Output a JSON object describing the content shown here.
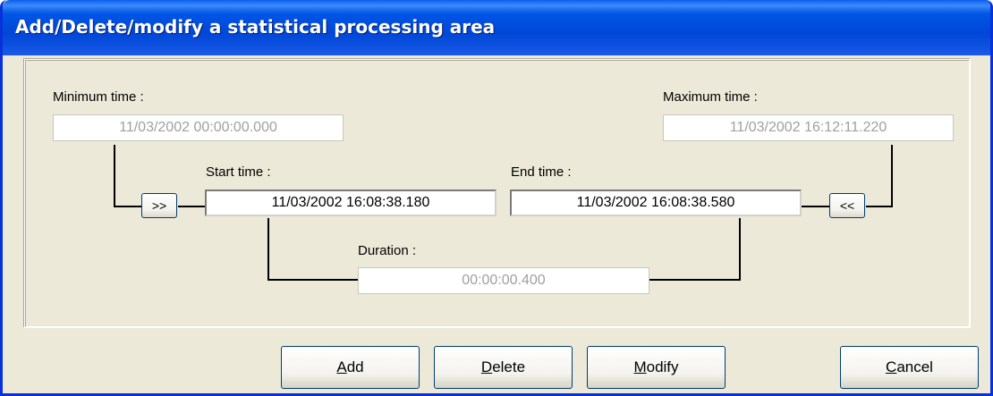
{
  "window": {
    "title": "Add/Delete/modify a statistical processing area"
  },
  "fields": {
    "minimum_time": {
      "label": "Minimum time :",
      "value": "11/03/2002 00:00:00.000"
    },
    "maximum_time": {
      "label": "Maximum time :",
      "value": "11/03/2002 16:12:11.220"
    },
    "start_time": {
      "label": "Start time :",
      "value": "11/03/2002 16:08:38.180"
    },
    "end_time": {
      "label": "End time :",
      "value": "11/03/2002 16:08:38.580"
    },
    "duration": {
      "label": "Duration :",
      "value": "00:00:00.400"
    }
  },
  "small_buttons": {
    "copy_min": ">>",
    "copy_max": "<<"
  },
  "buttons": {
    "add": {
      "mnemonic": "A",
      "rest": "dd"
    },
    "delete": {
      "mnemonic": "D",
      "rest": "elete"
    },
    "modify": {
      "mnemonic": "M",
      "rest": "odify"
    },
    "cancel": {
      "mnemonic": "C",
      "rest": "ancel"
    }
  },
  "colors": {
    "titlebar": "#0055e5",
    "dialog_bg": "#ece9d8",
    "disabled_text": "#a0a0a0"
  }
}
